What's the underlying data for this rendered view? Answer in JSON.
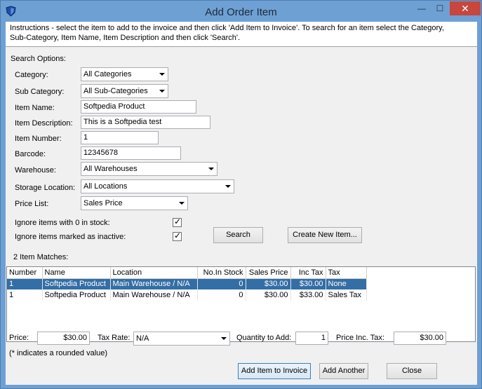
{
  "window": {
    "title": "Add Order Item",
    "min_glyph": "—",
    "max_glyph": "☐",
    "close_glyph": "✕"
  },
  "instructions": {
    "line1": "Instructions - select the item to add to the invoice and then click 'Add Item to Invoice'. To search for an item select the Category,",
    "line2": "Sub-Category, Item Name, Item Description and then click 'Search'."
  },
  "search": {
    "section_label": "Search Options:",
    "category_label": "Category:",
    "category_value": "All Categories",
    "subcategory_label": "Sub Category:",
    "subcategory_value": "All Sub-Categories",
    "item_name_label": "Item Name:",
    "item_name_value": "Softpedia Product",
    "item_desc_label": "Item Description:",
    "item_desc_value": "This is a Softpedia test",
    "item_number_label": "Item Number:",
    "item_number_value": "1",
    "barcode_label": "Barcode:",
    "barcode_value": "12345678",
    "warehouse_label": "Warehouse:",
    "warehouse_value": "All Warehouses",
    "storage_label": "Storage Location:",
    "storage_value": "All Locations",
    "price_list_label": "Price List:",
    "price_list_value": "Sales Price",
    "ignore_zero_label": "Ignore items with 0 in stock:",
    "ignore_inactive_label": "Ignore items marked as inactive:",
    "check_glyph": "✓",
    "search_button": "Search",
    "create_button": "Create New Item..."
  },
  "results": {
    "matches_label": "2 Item Matches:",
    "columns": [
      "Number",
      "Name",
      "Location",
      "No.In Stock",
      "Sales Price",
      "Inc Tax",
      "Tax"
    ],
    "rows": [
      [
        "1",
        "Softpedia Product",
        "Main Warehouse / N/A",
        "0",
        "$30.00",
        "$30.00",
        "None"
      ],
      [
        "1",
        "Softpedia Product",
        "Main Warehouse / N/A",
        "0",
        "$30.00",
        "$33.00",
        "Sales Tax"
      ]
    ]
  },
  "footer": {
    "price_label": "Price:",
    "price_value": "$30.00",
    "tax_rate_label": "Tax Rate:",
    "tax_rate_value": "N/A",
    "qty_label": "Quantity to Add:",
    "qty_value": "1",
    "price_inc_label": "Price Inc. Tax:",
    "price_inc_value": "$30.00",
    "note": "(* indicates a rounded value)",
    "add_invoice_button": "Add Item to Invoice",
    "add_another_button": "Add Another",
    "close_button": "Close"
  },
  "colors": {
    "titlebar": "#6fa0d3",
    "close_button": "#c7473c",
    "selected_row": "#336ea5"
  }
}
